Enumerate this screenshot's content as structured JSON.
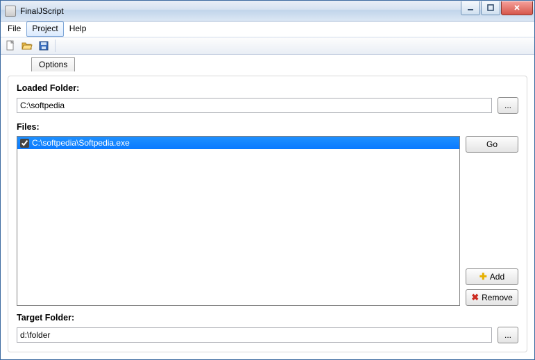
{
  "window": {
    "title": "FinalJScript"
  },
  "menu": {
    "file": "File",
    "project": "Project",
    "help": "Help",
    "open_item": "Project"
  },
  "tabs": {
    "options": "Options"
  },
  "labels": {
    "loaded_folder": "Loaded Folder:",
    "files": "Files:",
    "target_folder": "Target Folder:"
  },
  "inputs": {
    "loaded_folder": "C:\\softpedia",
    "target_folder": "d:\\folder"
  },
  "files": [
    {
      "path": "C:\\softpedia\\Softpedia.exe",
      "checked": true,
      "selected": true
    }
  ],
  "buttons": {
    "browse": "...",
    "go": "Go",
    "add": "Add",
    "remove": "Remove"
  }
}
